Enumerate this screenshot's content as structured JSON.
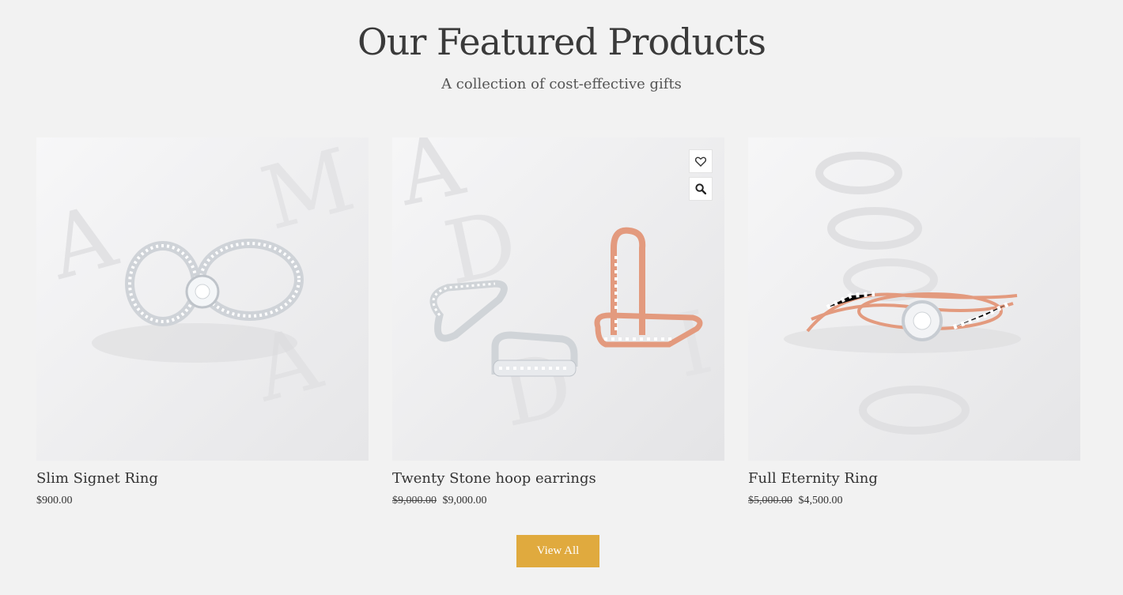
{
  "section": {
    "title": "Our Featured Products",
    "subtitle": "A collection of cost-effective gifts"
  },
  "products": [
    {
      "name": "Slim Signet Ring",
      "old_price": "",
      "price": "$900.00",
      "metal": "white-gold",
      "image": "ring-icon"
    },
    {
      "name": "Twenty Stone hoop earrings",
      "old_price": "$9,000.00",
      "price": "$9,000.00",
      "metal": "white-and-rose-gold",
      "image": "earrings-icon"
    },
    {
      "name": "Full Eternity Ring",
      "old_price": "$5,000.00",
      "price": "$4,500.00",
      "metal": "rose-gold",
      "image": "ring-icon"
    }
  ],
  "actions": {
    "wishlist_icon": "heart-icon",
    "quickview_icon": "search-icon"
  },
  "view_all_label": "View All",
  "colors": {
    "background": "#f2f2f2",
    "button": "#e0aa3e",
    "rose_gold": "#e39a7e",
    "silver": "#cfd3d8"
  }
}
